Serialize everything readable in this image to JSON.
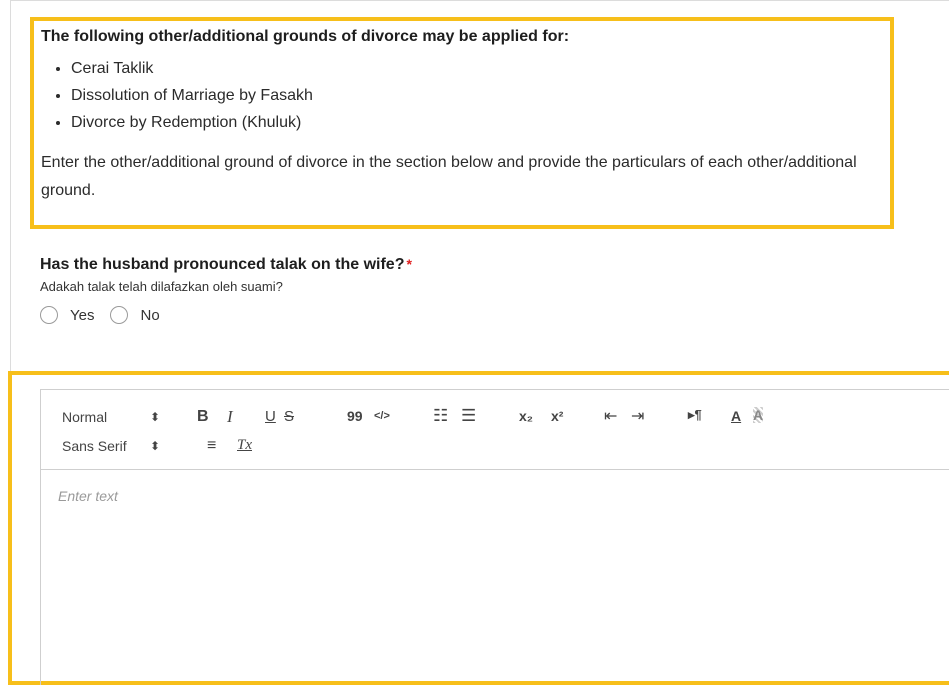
{
  "info": {
    "heading": "The following other/additional grounds of divorce may be applied for:",
    "grounds": [
      "Cerai Taklik",
      "Dissolution of Marriage by Fasakh",
      "Divorce by Redemption (Khuluk)"
    ],
    "instruction": "Enter the other/additional ground of divorce in the section below and provide the particulars of each other/additional ground."
  },
  "question": {
    "title": "Has the husband pronounced talak on the wife?",
    "required_mark": "*",
    "subtitle": "Adakah talak telah dilafazkan oleh suami?",
    "options": [
      "Yes",
      "No"
    ]
  },
  "editor": {
    "size_picker": "Normal",
    "font_picker": "Sans Serif",
    "caret": "⬍",
    "buttons": {
      "bold": "B",
      "italic": "I",
      "underline": "U",
      "strike": "S",
      "blockquote": "99",
      "code": "</>",
      "ordered_list": "☷",
      "bullet_list": "☰",
      "subscript": "x₂",
      "superscript": "x²",
      "outdent": "⇤",
      "indent": "⇥",
      "direction": "▸¶",
      "color": "A",
      "background": "A",
      "align": "≡",
      "clean": "Tx"
    },
    "placeholder": "Enter text"
  },
  "colors": {
    "highlight_border": "#f7bf1a",
    "required": "#e02020"
  }
}
